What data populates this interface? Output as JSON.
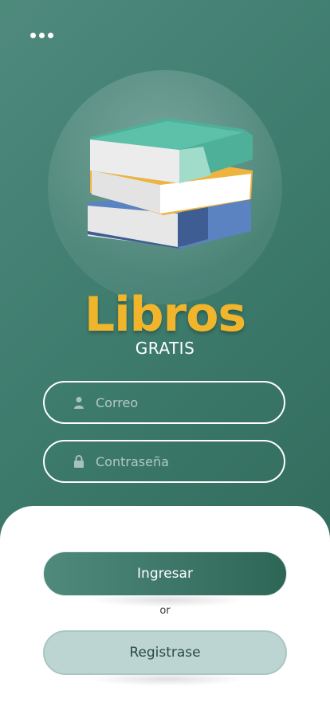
{
  "header": {
    "menu_icon": "more-horizontal-icon"
  },
  "hero": {
    "illustration": "books-stack-icon"
  },
  "brand": {
    "title": "Libros",
    "subtitle": "GRATIS"
  },
  "form": {
    "email": {
      "icon": "user-icon",
      "placeholder": "Correo",
      "value": ""
    },
    "password": {
      "icon": "lock-icon",
      "placeholder": "Contraseña",
      "value": ""
    }
  },
  "actions": {
    "login_label": "Ingresar",
    "separator": "or",
    "register_label": "Registrase"
  },
  "colors": {
    "primary_gradient_start": "#4f8a7d",
    "primary_gradient_end": "#2e6656",
    "accent": "#f0b52a",
    "secondary_button": "#bcd5d2"
  }
}
